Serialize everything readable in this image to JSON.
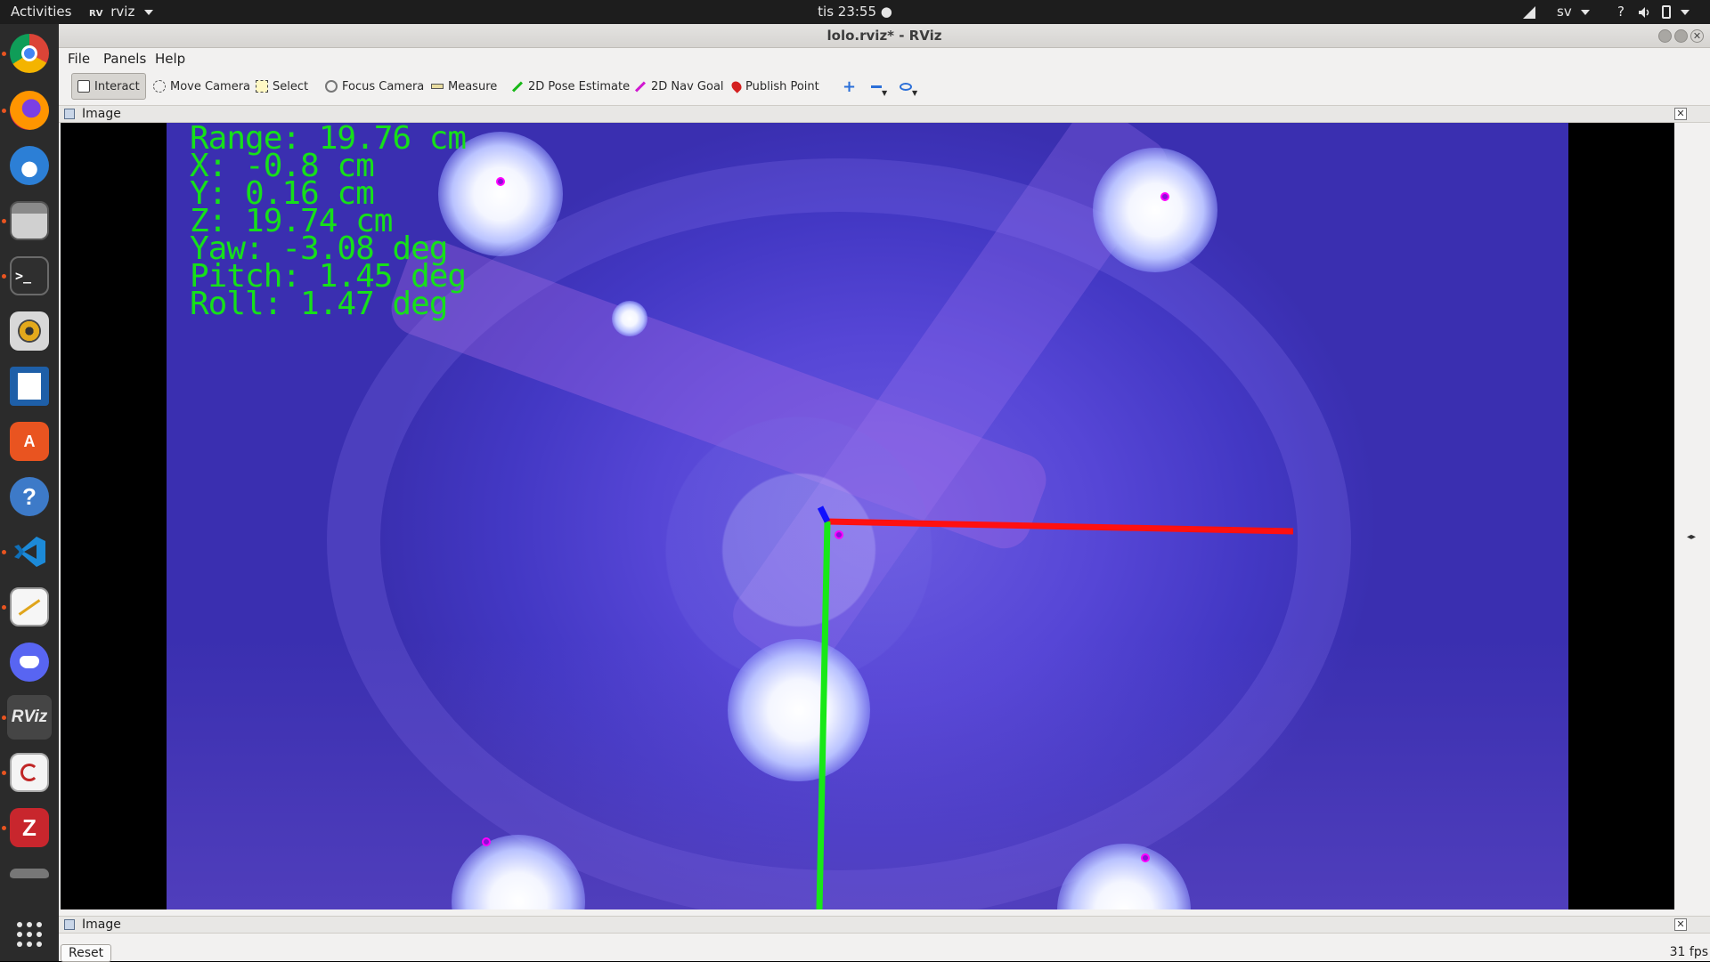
{
  "topbar": {
    "activities": "Activities",
    "app_menu": "rviz",
    "clock": "tis 23:55 ●",
    "lang": "sv",
    "help": "?"
  },
  "dock": {
    "apps": [
      "chrome-icon",
      "firefox-icon",
      "thunderbird-icon",
      "files-icon",
      "terminal-icon",
      "rhythmbox-icon",
      "writer-icon",
      "software-icon",
      "help-icon",
      "vscode-icon",
      "text-editor-icon",
      "discord-icon",
      "rviz-icon",
      "evince-icon",
      "zotero-icon",
      "drive-icon",
      "show-apps-icon"
    ],
    "rviz_label": "RViz",
    "zotero_label": "Z"
  },
  "window": {
    "title": "lolo.rviz* - RViz"
  },
  "menu": {
    "file": "File",
    "panels": "Panels",
    "help": "Help"
  },
  "toolbar": {
    "interact": "Interact",
    "move_camera": "Move Camera",
    "select": "Select",
    "focus_camera": "Focus Camera",
    "measure": "Measure",
    "pose_estimate": "2D Pose Estimate",
    "nav_goal": "2D Nav Goal",
    "publish_point": "Publish Point"
  },
  "panels": {
    "top_title": "Image",
    "bottom_title": "Image"
  },
  "overlay": {
    "range": "Range: 19.76 cm",
    "x": "X: -0.8 cm",
    "y": "Y: 0.16 cm",
    "z": "Z: 19.74 cm",
    "yaw": "Yaw: -3.08 deg",
    "pitch": "Pitch: 1.45 deg",
    "roll": "Roll: 1.47 deg"
  },
  "bottom": {
    "reset": "Reset",
    "fps": "31 fps"
  },
  "colors": {
    "overlay_text": "#16e01a",
    "axis_x": "#ff1010",
    "axis_y": "#18e818",
    "axis_z": "#1010ff",
    "marker": "#ff00ff"
  }
}
